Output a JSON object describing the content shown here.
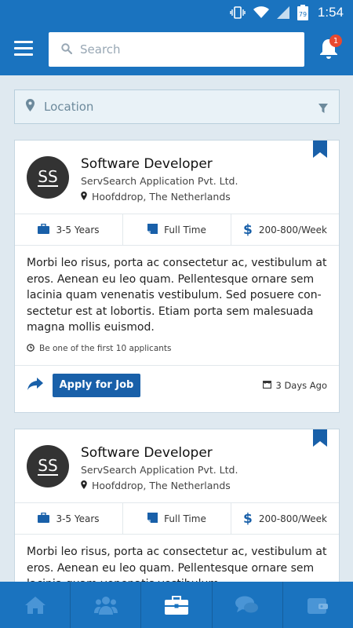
{
  "status_bar": {
    "time": "1:54",
    "battery": "79"
  },
  "header": {
    "search_placeholder": "Search",
    "notification_count": "1"
  },
  "location": {
    "placeholder": "Location"
  },
  "jobs": [
    {
      "avatar": "SS",
      "title": "Software Developer",
      "company": "ServSearch Application Pvt. Ltd.",
      "place": "Hoofddrop, The Netherlands",
      "experience": "3-5 Years",
      "type": "Full Time",
      "salary": "200-800/Week",
      "description": "Morbi leo risus, porta ac consectetur ac, vestibulum at eros. Aenean eu leo quam. Pellentesque ornare sem lacinia quam venenatis vestibulum. Sed posuere con­sectetur est at lobortis. Etiam porta sem malesuada magna mollis euismod.",
      "applicants": "Be one of the first 10 applicants",
      "apply_label": "Apply for Job",
      "posted": "3 Days Ago"
    },
    {
      "avatar": "SS",
      "title": "Software Developer",
      "company": "ServSearch Application Pvt. Ltd.",
      "place": "Hoofddrop, The Netherlands",
      "experience": "3-5 Years",
      "type": "Full Time",
      "salary": "200-800/Week",
      "description": "Morbi leo risus, porta ac consectetur ac, vestibulum at eros. Aenean eu leo quam. Pellentesque ornare sem lacinia quam venenatis vestibulum."
    }
  ],
  "colors": {
    "primary": "#1a73bf",
    "button": "#1960a9",
    "badge": "#e8492f"
  },
  "bottom_nav": [
    "home-icon",
    "users-icon",
    "briefcase-icon",
    "chat-icon",
    "wallet-icon"
  ]
}
